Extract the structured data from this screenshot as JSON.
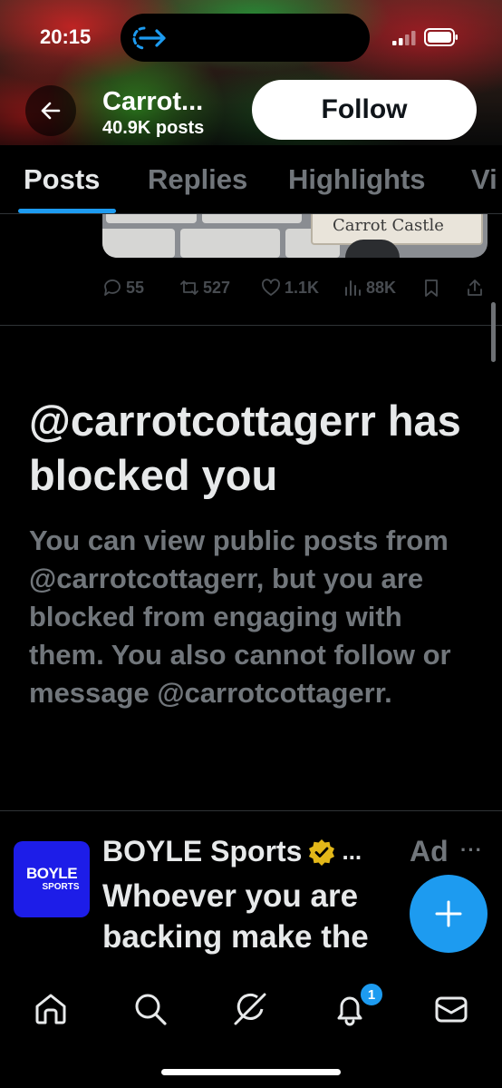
{
  "status_bar": {
    "time": "20:15"
  },
  "header": {
    "profile_name": "Carrot...",
    "post_count": "40.9K posts",
    "follow_label": "Follow"
  },
  "tabs": [
    {
      "label": "Posts",
      "active": true
    },
    {
      "label": "Replies",
      "active": false
    },
    {
      "label": "Highlights",
      "active": false
    },
    {
      "label": "Vi",
      "active": false
    }
  ],
  "previous_post": {
    "image_text": "Carrot Castle",
    "replies": "55",
    "reposts": "527",
    "likes": "1.1K",
    "views": "88K"
  },
  "blocked_notice": {
    "title": "@carrotcottagerr has blocked you",
    "body": "You can view public posts from @carrotcottagerr, but you are blocked from engaging with them. You also cannot follow or message @carrotcottagerr."
  },
  "ad": {
    "logo_top": "BOYLE",
    "logo_bottom": "SPORTS",
    "name": "BOYLE Sports",
    "ellipsis": "...",
    "tag": "Ad",
    "more": "···",
    "text": "Whoever you are backing make the"
  },
  "bottom_nav": {
    "items": [
      "home-icon",
      "search-icon",
      "grok-icon",
      "notifications-icon",
      "messages-icon"
    ],
    "notification_count": "1"
  },
  "colors": {
    "accent": "#1d9bf0",
    "background": "#000000",
    "primary_text": "#e7e9ea",
    "secondary_text": "#71767b",
    "verified_gold": "#e2b719"
  }
}
